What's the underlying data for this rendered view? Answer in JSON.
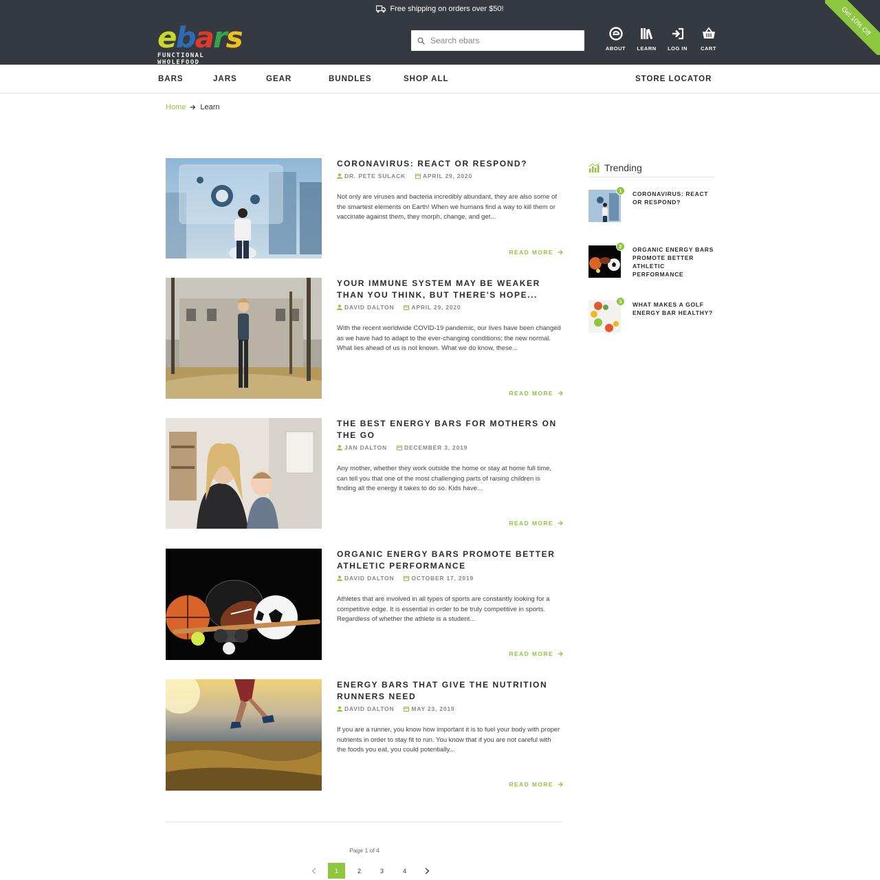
{
  "announcement": {
    "text": "Free shipping on orders over $50!",
    "icon": "truck-icon"
  },
  "brand": {
    "logo_text": "ebars",
    "tagline": "FUNCTIONAL WHOLEFOOD"
  },
  "search": {
    "placeholder": "Search ebars",
    "icon": "search-icon"
  },
  "header_icons": [
    {
      "label": "ABOUT",
      "icon": "ebars-e-icon"
    },
    {
      "label": "LEARN",
      "icon": "books-icon"
    },
    {
      "label": "LOG IN",
      "icon": "login-icon"
    },
    {
      "label": "CART",
      "icon": "basket-icon"
    }
  ],
  "promo_ribbon": {
    "text": "Get 10% Off"
  },
  "nav": {
    "items": [
      "BARS",
      "JARS",
      "GEAR",
      "BUNDLES",
      "SHOP ALL"
    ],
    "store_locator": "STORE LOCATOR"
  },
  "breadcrumb": {
    "home": "Home",
    "current": "Learn"
  },
  "posts": [
    {
      "title": "CORONAVIRUS: REACT OR RESPOND?",
      "author": "DR. PETE SULACK",
      "date": "APRIL 29, 2020",
      "excerpt": "Not only are viruses and bacteria incredibly abundant, they are also some of the smartest elements on Earth! When we humans find a way to kill them or vaccinate against them, they morph, change, and get...",
      "read_more": "READ MORE"
    },
    {
      "title": "YOUR IMMUNE SYSTEM MAY BE WEAKER THAN YOU THINK, BUT THERE'S HOPE...",
      "author": "DAVID DALTON",
      "date": "APRIL 29, 2020",
      "excerpt": "With the recent worldwide COVID-19 pandemic, our lives have been changed as we have had to adapt to the ever-changing conditions; the new normal. What lies ahead of us is not known. What we do know, these...",
      "read_more": "READ MORE"
    },
    {
      "title": "THE BEST ENERGY BARS FOR MOTHERS ON THE GO",
      "author": "JAN DALTON",
      "date": "DECEMBER 3, 2019",
      "excerpt": "Any mother, whether they work outside the home or stay at home full time, can tell you that one of the most challenging parts of raising children is finding all the energy it takes to do so. Kids have...",
      "read_more": "READ MORE"
    },
    {
      "title": "ORGANIC ENERGY BARS PROMOTE BETTER ATHLETIC PERFORMANCE",
      "author": "DAVID DALTON",
      "date": "OCTOBER 17, 2019",
      "excerpt": "Athletes that are involved in all types of sports are constantly looking for a competitive edge. It is essential in order to be truly competitive in sports. Regardless of whether the athlete is a student...",
      "read_more": "READ MORE"
    },
    {
      "title": "ENERGY BARS THAT GIVE THE NUTRITION RUNNERS NEED",
      "author": "DAVID DALTON",
      "date": "MAY 23, 2019",
      "excerpt": "If you are a runner, you know how important it is to fuel your body with proper nutrients in order to stay fit to run. You know that if you are not careful with the foods you eat, you could potentially...",
      "read_more": "READ MORE"
    }
  ],
  "pagination": {
    "info": "Page 1 of 4",
    "pages": [
      "1",
      "2",
      "3",
      "4"
    ],
    "current": "1"
  },
  "trending": {
    "heading": "Trending",
    "items": [
      {
        "num": "1",
        "title": "CORONAVIRUS: REACT OR RESPOND?"
      },
      {
        "num": "2",
        "title": "ORGANIC ENERGY BARS PROMOTE BETTER ATHLETIC PERFORMANCE"
      },
      {
        "num": "3",
        "title": "WHAT MAKES A GOLF ENERGY BAR HEALTHY?"
      }
    ]
  },
  "colors": {
    "accent": "#8dc63f",
    "header_bg": "#353a40"
  }
}
